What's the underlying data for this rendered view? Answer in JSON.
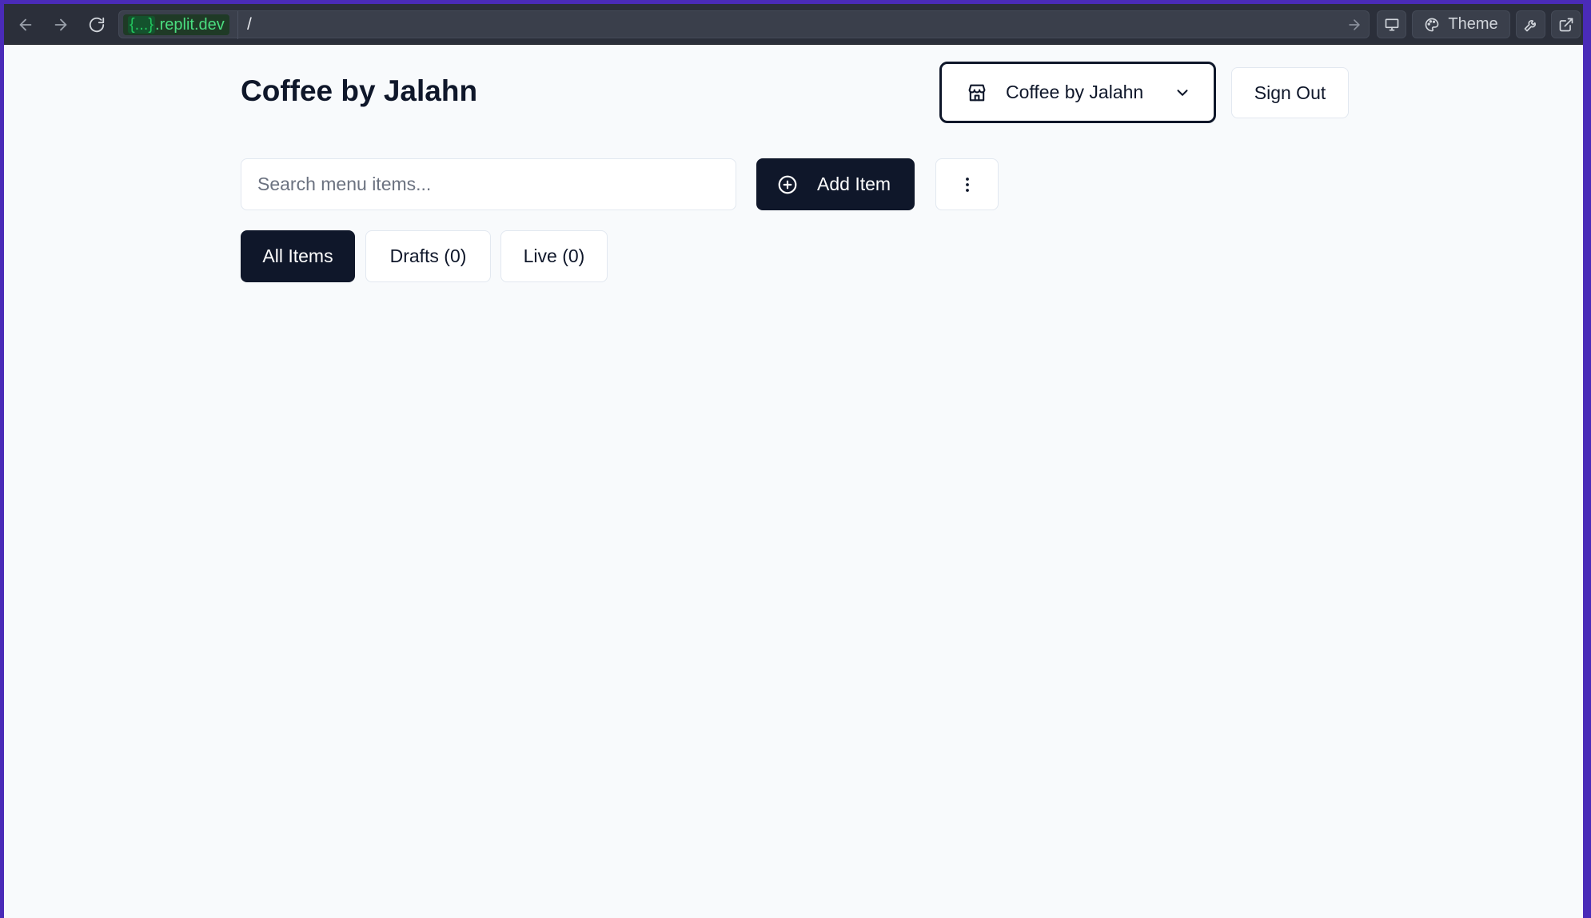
{
  "browser": {
    "url_host_prefix": "{...}",
    "url_host_suffix": ".replit.dev",
    "url_path": "/",
    "theme_label": "Theme",
    "icons": [
      "back-arrow-icon",
      "forward-arrow-icon",
      "reload-icon",
      "go-arrow-icon",
      "device-icon",
      "palette-icon",
      "wrench-icon",
      "external-link-icon"
    ]
  },
  "header": {
    "title": "Coffee by Jalahn",
    "store_selector": {
      "selected": "Coffee by Jalahn",
      "icon": "store-icon"
    },
    "sign_out_label": "Sign Out"
  },
  "toolbar": {
    "search_placeholder": "Search menu items...",
    "search_value": "",
    "add_item_label": "Add Item",
    "add_item_icon": "plus-circle-icon",
    "more_icon": "more-vertical-icon"
  },
  "filters": [
    {
      "label": "All Items",
      "active": true
    },
    {
      "label": "Drafts (0)",
      "active": false
    },
    {
      "label": "Live (0)",
      "active": false
    }
  ],
  "colors": {
    "primary": "#0f172a",
    "background": "#f8fafc",
    "border": "#e2e8f0",
    "window_frame": "#4a2bb8",
    "url_host": "#4ade80"
  }
}
